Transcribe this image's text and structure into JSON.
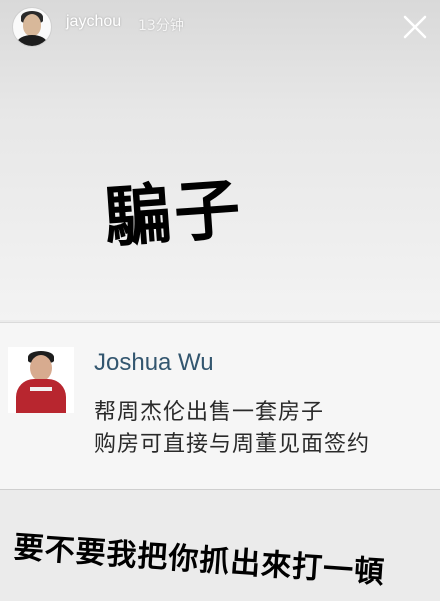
{
  "story": {
    "username": "jaychou",
    "timestamp": "13分钟",
    "headline": "騙子"
  },
  "icons": {
    "close": "close-icon",
    "avatar": "avatar"
  },
  "post": {
    "author": "Joshua Wu",
    "line1": "帮周杰伦出售一套房子",
    "line2": "购房可直接与周董见面签约"
  },
  "caption": "要不要我把你抓出來打一頓"
}
